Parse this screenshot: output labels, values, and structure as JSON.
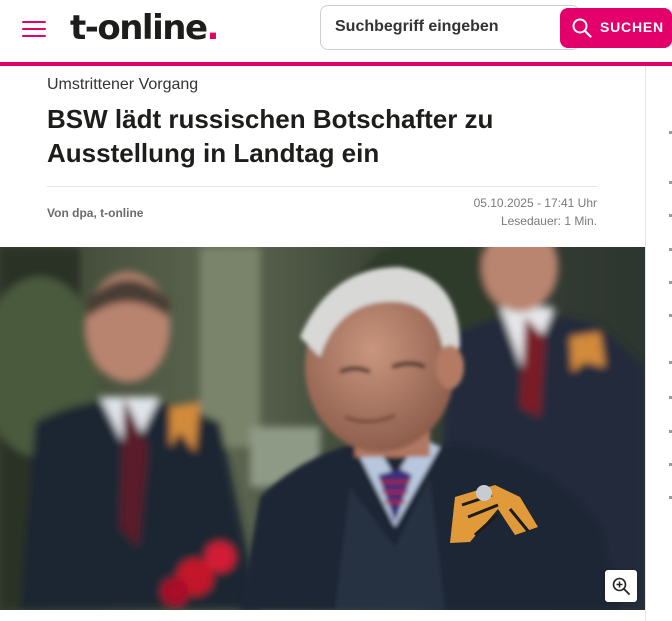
{
  "header": {
    "logo_text": "t-online",
    "logo_dot": ".",
    "search_placeholder": "Suchbegriff eingeben",
    "search_button_label": "SUCHEN",
    "brand_color": "#e3006a"
  },
  "article": {
    "kicker": "Umstrittener Vorgang",
    "headline": "BSW lädt russischen Botschafter zu Ausstellung in Landtag ein",
    "byline_prefix": "Von",
    "byline_authors": "dpa, t-online",
    "date": "05.10.2025 - 17:41 Uhr",
    "read_time": "Lesedauer: 1 Min."
  },
  "icons": {
    "menu": "hamburger-menu-icon",
    "search": "search-icon",
    "zoom": "zoom-in-icon"
  }
}
